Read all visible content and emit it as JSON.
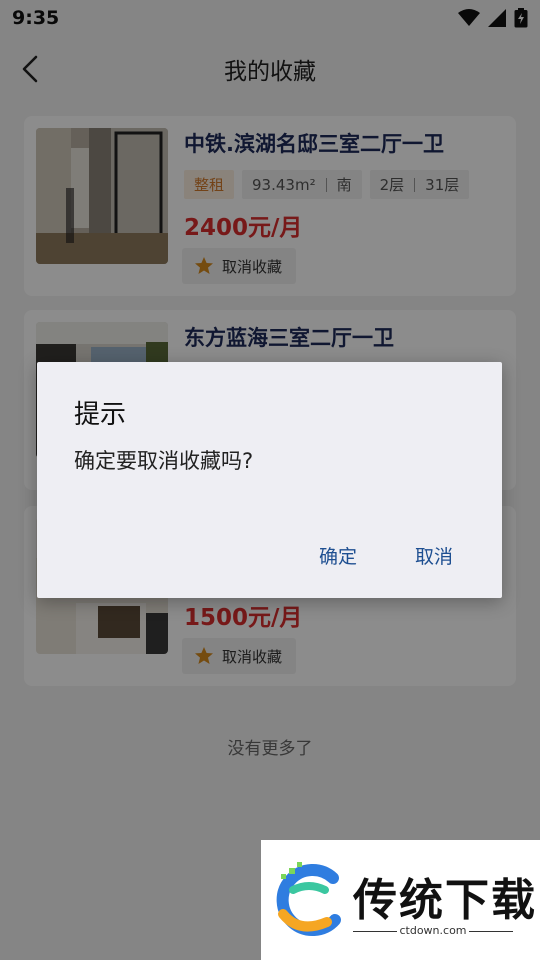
{
  "status_bar": {
    "time": "9:35"
  },
  "header": {
    "title": "我的收藏"
  },
  "listings": [
    {
      "title": "中铁.滨湖名邸三室二厅一卫",
      "type": "整租",
      "area": "93.43m²",
      "orientation": "南",
      "floor": "2层",
      "total_floors": "31层",
      "price": "2400元/月",
      "unfavorite_label": "取消收藏"
    },
    {
      "title": "东方蓝海三室二厅一卫"
    },
    {
      "price": "1500元/月",
      "unfavorite_label": "取消收藏"
    }
  ],
  "footer": {
    "no_more": "没有更多了"
  },
  "dialog": {
    "title": "提示",
    "message": "确定要取消收藏吗?",
    "confirm_label": "确定",
    "cancel_label": "取消"
  },
  "watermark": {
    "brand": "传统下载",
    "url": "ctdown.com"
  },
  "colors": {
    "title": "#1e2a5a",
    "price": "#d92f2f",
    "accent": "#1e4f91",
    "tag": "#d27b2d",
    "star": "#d68a1e"
  }
}
